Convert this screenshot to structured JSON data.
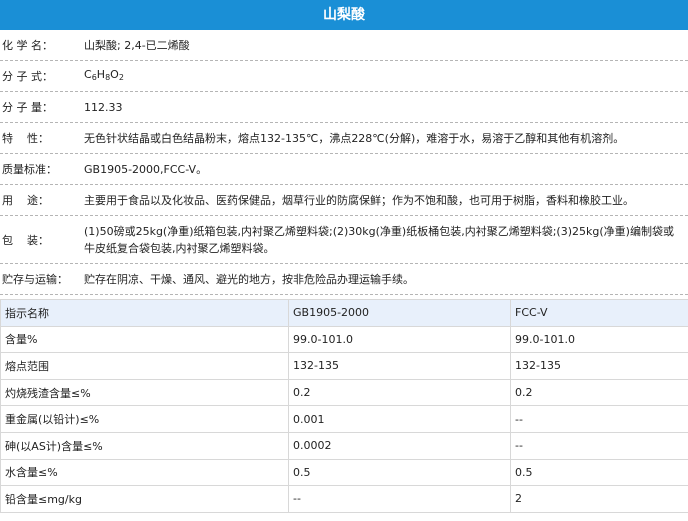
{
  "title": "山梨酸",
  "info": [
    {
      "label": "化 学 名：",
      "value": "山梨酸; 2,4-已二烯酸"
    },
    {
      "label": "分 子 式：",
      "formula": [
        "C",
        "6",
        "H",
        "8",
        "O",
        "2"
      ]
    },
    {
      "label": "分 子 量：",
      "value": "112.33"
    },
    {
      "label": "特    性：",
      "value": "无色针状结晶或白色结晶粉末，熔点132-135℃，沸点228℃(分解)，难溶于水，易溶于乙醇和其他有机溶剂。"
    },
    {
      "label": "质量标准：",
      "value": "GB1905-2000,FCC-V。"
    },
    {
      "label": "用    途：",
      "value": "主要用于食品以及化妆品、医药保健品，烟草行业的防腐保鲜；作为不饱和酸，也可用于树脂，香料和橡胶工业。"
    },
    {
      "label": "包    装：",
      "value": "(1)50磅或25kg(净重)纸箱包装,内衬聚乙烯塑料袋;(2)30kg(净重)纸板桶包装,内衬聚乙烯塑料袋;(3)25kg(净重)编制袋或牛皮纸复合袋包装,内衬聚乙烯塑料袋。"
    },
    {
      "label": "贮存与运输：",
      "value": "贮存在阴凉、干燥、通风、避光的地方，按非危险品办理运输手续。"
    }
  ],
  "spec_table": {
    "headers": [
      "指示名称",
      "GB1905-2000",
      "FCC-V"
    ],
    "rows": [
      [
        "含量%",
        "99.0-101.0",
        "99.0-101.0"
      ],
      [
        "熔点范围",
        "132-135",
        "132-135"
      ],
      [
        "灼烧残渣含量≤%",
        "0.2",
        "0.2"
      ],
      [
        "重金属(以铅计)≤%",
        "0.001",
        "--"
      ],
      [
        "砷(以AS计)含量≤%",
        "0.0002",
        "--"
      ],
      [
        "水含量≤%",
        "0.5",
        "0.5"
      ],
      [
        "铅含量≤mg/kg",
        "--",
        "2"
      ]
    ]
  }
}
